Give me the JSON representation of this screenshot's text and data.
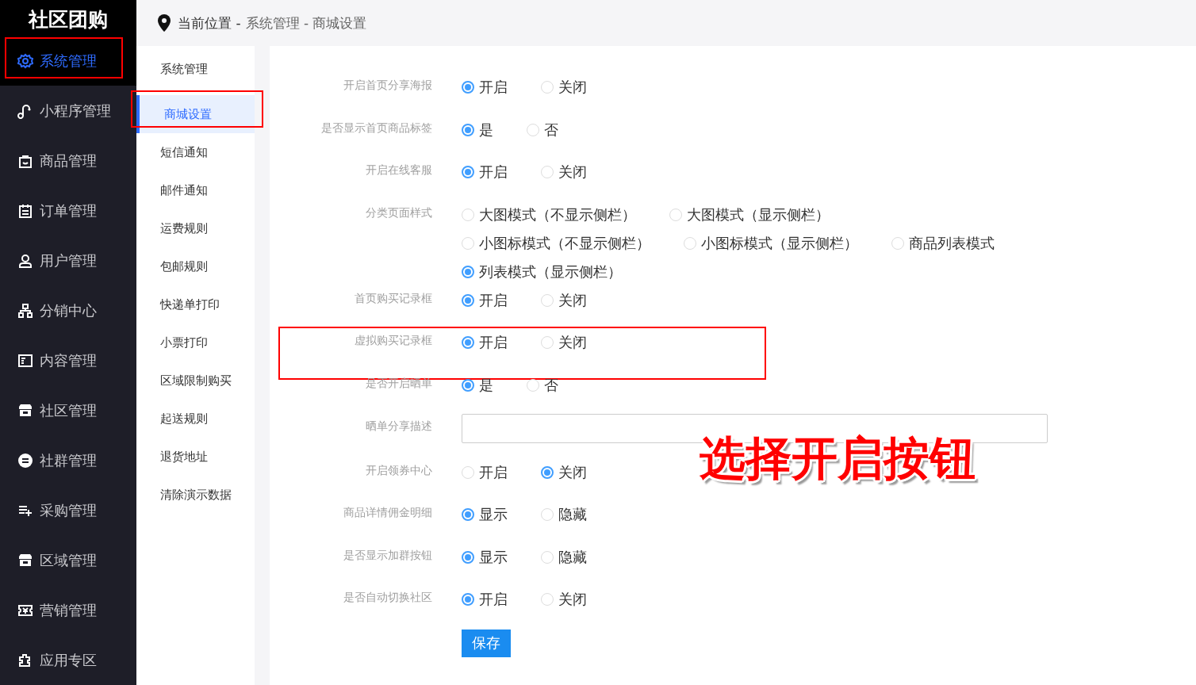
{
  "logo": "社区团购",
  "sidebar": {
    "items": [
      {
        "label": "系统管理",
        "selected": true,
        "highlighted": true
      },
      {
        "label": "小程序管理",
        "selected": false,
        "highlighted": false
      },
      {
        "label": "商品管理",
        "selected": false,
        "highlighted": false
      },
      {
        "label": "订单管理",
        "selected": false,
        "highlighted": false
      },
      {
        "label": "用户管理",
        "selected": false,
        "highlighted": false
      },
      {
        "label": "分销中心",
        "selected": false,
        "highlighted": false
      },
      {
        "label": "内容管理",
        "selected": false,
        "highlighted": false
      },
      {
        "label": "社区管理",
        "selected": false,
        "highlighted": false
      },
      {
        "label": "社群管理",
        "selected": false,
        "highlighted": false
      },
      {
        "label": "采购管理",
        "selected": false,
        "highlighted": false
      },
      {
        "label": "区域管理",
        "selected": false,
        "highlighted": false
      },
      {
        "label": "营销管理",
        "selected": false,
        "highlighted": false
      },
      {
        "label": "应用专区",
        "selected": false,
        "highlighted": false
      }
    ]
  },
  "header": {
    "location_label": "当前位置 -",
    "path": "系统管理 - 商城设置"
  },
  "submenu": {
    "title": "系统管理",
    "items": [
      {
        "label": "商城设置",
        "selected": true,
        "highlighted": true
      },
      {
        "label": "短信通知",
        "selected": false,
        "highlighted": false
      },
      {
        "label": "邮件通知",
        "selected": false,
        "highlighted": false
      },
      {
        "label": "运费规则",
        "selected": false,
        "highlighted": false
      },
      {
        "label": "包邮规则",
        "selected": false,
        "highlighted": false
      },
      {
        "label": "快递单打印",
        "selected": false,
        "highlighted": false
      },
      {
        "label": "小票打印",
        "selected": false,
        "highlighted": false
      },
      {
        "label": "区域限制购买",
        "selected": false,
        "highlighted": false
      },
      {
        "label": "起送规则",
        "selected": false,
        "highlighted": false
      },
      {
        "label": "退货地址",
        "selected": false,
        "highlighted": false
      },
      {
        "label": "清除演示数据",
        "selected": false,
        "highlighted": false
      }
    ]
  },
  "form": {
    "rows": [
      {
        "kind": "radio",
        "label": "开启首页分享海报",
        "highlighted": false,
        "options": [
          {
            "label": "开启",
            "selected": true
          },
          {
            "label": "关闭",
            "selected": false
          }
        ]
      },
      {
        "kind": "radio",
        "label": "是否显示首页商品标签",
        "highlighted": false,
        "options": [
          {
            "label": "是",
            "selected": true
          },
          {
            "label": "否",
            "selected": false
          }
        ]
      },
      {
        "kind": "radio",
        "label": "开启在线客服",
        "highlighted": false,
        "options": [
          {
            "label": "开启",
            "selected": true
          },
          {
            "label": "关闭",
            "selected": false
          }
        ]
      },
      {
        "kind": "radio",
        "label": "分类页面样式",
        "highlighted": false,
        "options": [
          {
            "label": "大图模式（不显示侧栏）",
            "selected": false
          },
          {
            "label": "大图模式（显示侧栏）",
            "selected": false
          },
          {
            "label": "小图标模式（不显示侧栏）",
            "selected": false
          },
          {
            "label": "小图标模式（显示侧栏）",
            "selected": false
          },
          {
            "label": "商品列表模式",
            "selected": false
          },
          {
            "label": "列表模式（显示侧栏）",
            "selected": true
          }
        ]
      },
      {
        "kind": "radio",
        "label": "首页购买记录框",
        "highlighted": false,
        "options": [
          {
            "label": "开启",
            "selected": true
          },
          {
            "label": "关闭",
            "selected": false
          }
        ]
      },
      {
        "kind": "radio",
        "label": "虚拟购买记录框",
        "highlighted": true,
        "options": [
          {
            "label": "开启",
            "selected": true
          },
          {
            "label": "关闭",
            "selected": false
          }
        ]
      },
      {
        "kind": "radio",
        "label": "是否开启晒单",
        "highlighted": false,
        "options": [
          {
            "label": "是",
            "selected": true
          },
          {
            "label": "否",
            "selected": false
          }
        ]
      },
      {
        "kind": "text",
        "label": "晒单分享描述",
        "highlighted": false
      },
      {
        "kind": "radio",
        "label": "开启领券中心",
        "highlighted": false,
        "options": [
          {
            "label": "开启",
            "selected": false
          },
          {
            "label": "关闭",
            "selected": true
          }
        ]
      },
      {
        "kind": "radio",
        "label": "商品详情佣金明细",
        "highlighted": false,
        "options": [
          {
            "label": "显示",
            "selected": true
          },
          {
            "label": "隐藏",
            "selected": false
          }
        ]
      },
      {
        "kind": "radio",
        "label": "是否显示加群按钮",
        "highlighted": false,
        "options": [
          {
            "label": "显示",
            "selected": true
          },
          {
            "label": "隐藏",
            "selected": false
          }
        ]
      },
      {
        "kind": "radio",
        "label": "是否自动切换社区",
        "highlighted": false,
        "options": [
          {
            "label": "开启",
            "selected": true
          },
          {
            "label": "关闭",
            "selected": false
          }
        ]
      }
    ],
    "save_button": "保存"
  },
  "annotation": "选择开启按钮"
}
